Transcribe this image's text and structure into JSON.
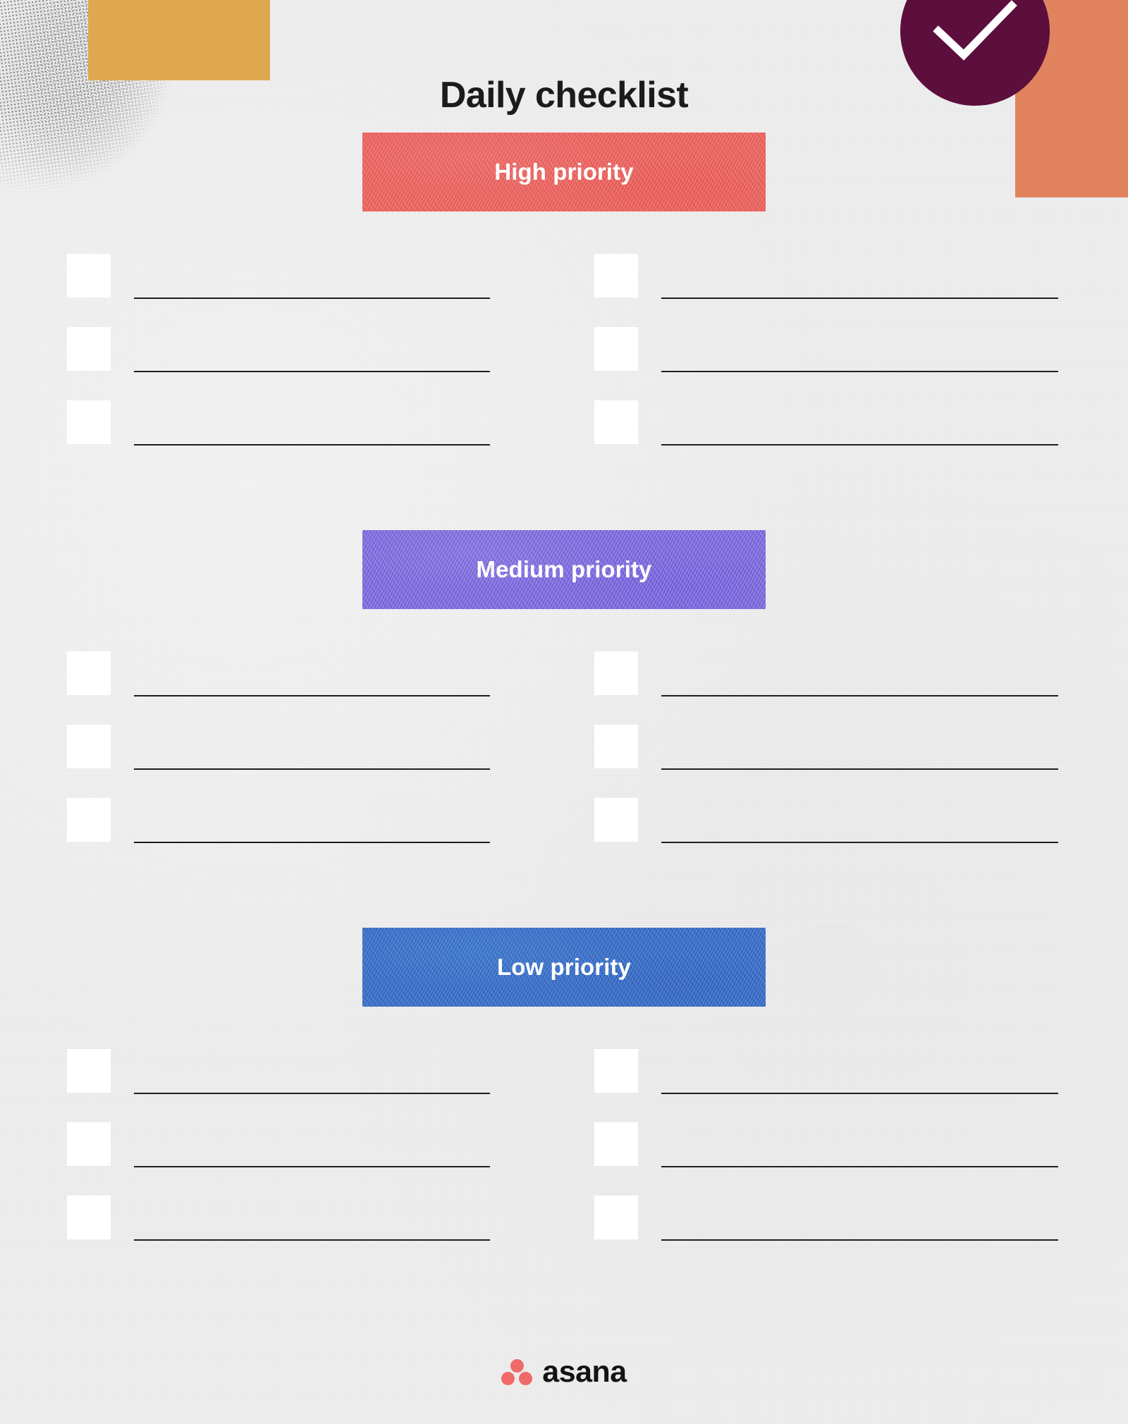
{
  "page": {
    "title": "Daily checklist",
    "background_color": "#ebeaea"
  },
  "decorations": {
    "mustard_rect_color": "#e0a84e",
    "coral_rect_color": "#e1835e",
    "check_circle_color": "#5c0e3c",
    "check_mark_color": "#ffffff",
    "check_icon_name": "checkmark-icon"
  },
  "sections": [
    {
      "id": "high",
      "label": "High priority",
      "color": "#e8635f",
      "rows": [
        {
          "left": {
            "checked": false,
            "text": ""
          },
          "right": {
            "checked": false,
            "text": ""
          }
        },
        {
          "left": {
            "checked": false,
            "text": ""
          },
          "right": {
            "checked": false,
            "text": ""
          }
        },
        {
          "left": {
            "checked": false,
            "text": ""
          },
          "right": {
            "checked": false,
            "text": ""
          }
        }
      ]
    },
    {
      "id": "medium",
      "label": "Medium priority",
      "color": "#7b6bdb",
      "rows": [
        {
          "left": {
            "checked": false,
            "text": ""
          },
          "right": {
            "checked": false,
            "text": ""
          }
        },
        {
          "left": {
            "checked": false,
            "text": ""
          },
          "right": {
            "checked": false,
            "text": ""
          }
        },
        {
          "left": {
            "checked": false,
            "text": ""
          },
          "right": {
            "checked": false,
            "text": ""
          }
        }
      ]
    },
    {
      "id": "low",
      "label": "Low priority",
      "color": "#3e6dc4",
      "rows": [
        {
          "left": {
            "checked": false,
            "text": ""
          },
          "right": {
            "checked": false,
            "text": ""
          }
        },
        {
          "left": {
            "checked": false,
            "text": ""
          },
          "right": {
            "checked": false,
            "text": ""
          }
        },
        {
          "left": {
            "checked": false,
            "text": ""
          },
          "right": {
            "checked": false,
            "text": ""
          }
        }
      ]
    }
  ],
  "footer": {
    "brand": "asana",
    "logo_dot_color": "#f06a6a",
    "wordmark_color": "#131313"
  }
}
